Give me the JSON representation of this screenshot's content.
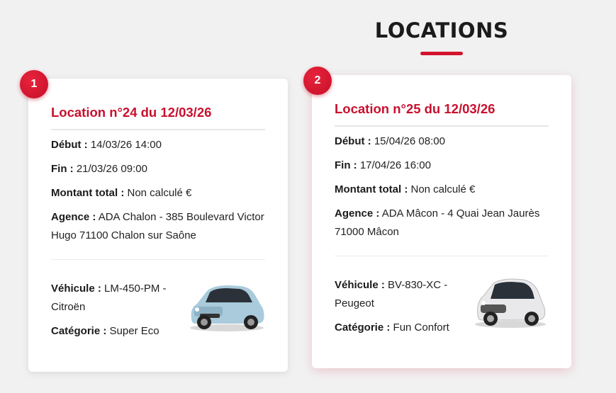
{
  "page": {
    "title": "LOCATIONS"
  },
  "cards": [
    {
      "badge": "1",
      "title": "Location n°24 du 12/03/26",
      "debut_label": "Début :",
      "debut_value": "14/03/26 14:00",
      "fin_label": "Fin :",
      "fin_value": "21/03/26 09:00",
      "montant_label": "Montant total :",
      "montant_value": "Non calculé €",
      "agence_label": "Agence :",
      "agence_value": "ADA Chalon - 385 Boulevard Victor Hugo 71100 Chalon sur Saône",
      "vehicule_label": "Véhicule :",
      "vehicule_value": "LM-450-PM - Citroën",
      "categorie_label": "Catégorie :",
      "categorie_value": "Super Eco",
      "car_color": "#a9cbdc"
    },
    {
      "badge": "2",
      "title": "Location n°25 du 12/03/26",
      "debut_label": "Début :",
      "debut_value": "15/04/26 08:00",
      "fin_label": "Fin :",
      "fin_value": "17/04/26 16:00",
      "montant_label": "Montant total :",
      "montant_value": "Non calculé €",
      "agence_label": "Agence :",
      "agence_value": "ADA Mâcon - 4 Quai Jean Jaurès 71000 Mâcon",
      "vehicule_label": "Véhicule :",
      "vehicule_value": "BV-830-XC - Peugeot",
      "categorie_label": "Catégorie :",
      "categorie_value": "Fun Confort",
      "car_color": "#e9e9ec"
    }
  ],
  "colors": {
    "accent": "#c8102e",
    "badge": "#d3142c",
    "background": "#f1f1f2"
  }
}
